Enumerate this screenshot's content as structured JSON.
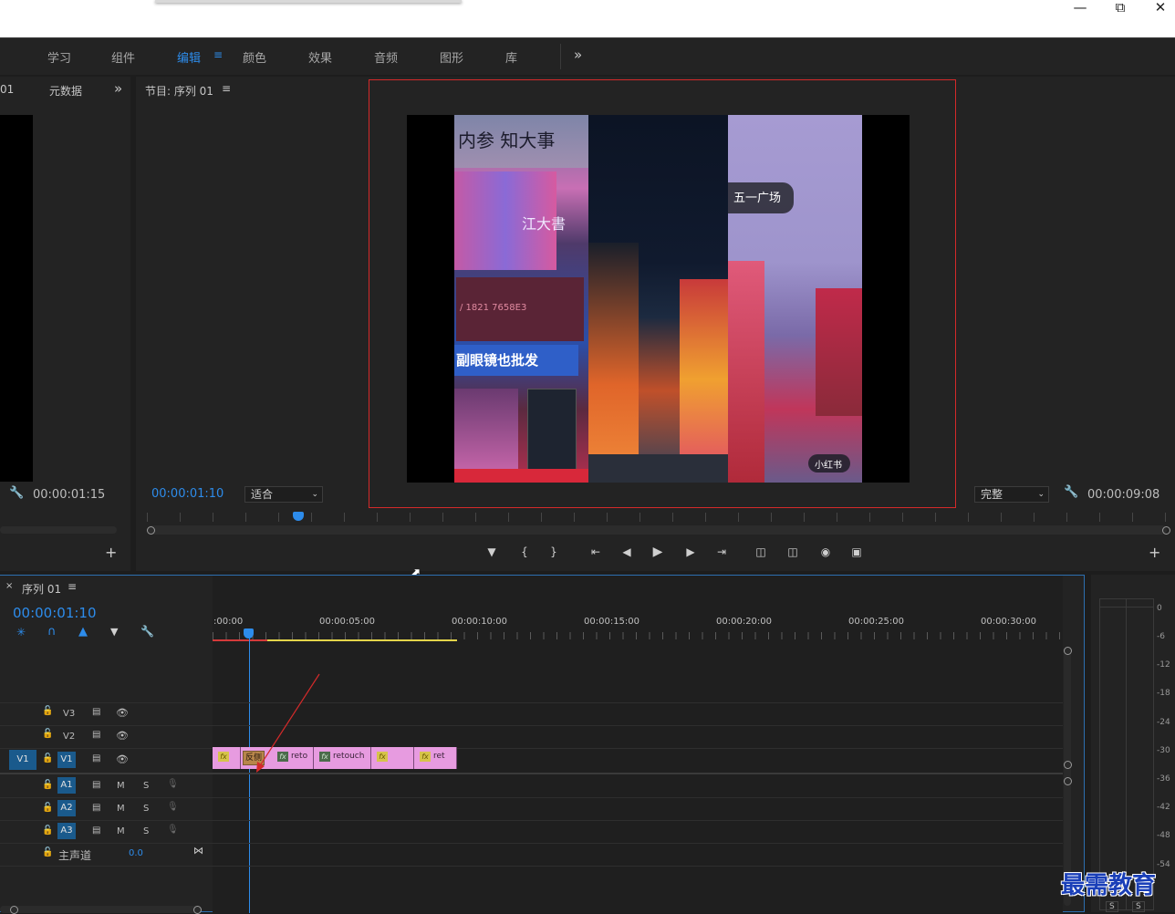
{
  "workspace_tabs": [
    "学习",
    "组件",
    "编辑",
    "颜色",
    "效果",
    "音频",
    "图形",
    "库"
  ],
  "active_workspace": "编辑",
  "source_panel": {
    "partial_tab": "01",
    "metadata_tab": "元数据",
    "timecode": "00:00:01:15"
  },
  "program_monitor": {
    "title": "节目: 序列 01",
    "timecode_current": "00:00:01:10",
    "fit_select": "适合",
    "quality_select": "完整",
    "timecode_duration": "00:00:09:08",
    "frame_text_1": "五一广场",
    "frame_text_2": "小红书",
    "frame_text_3": "副眼镜也批发"
  },
  "timeline": {
    "sequence_tab": "序列 01",
    "timecode": "00:00:01:10",
    "ruler_labels": [
      ":00:00",
      "00:00:05:00",
      "00:00:10:00",
      "00:00:15:00",
      "00:00:20:00",
      "00:00:25:00",
      "00:00:30:00"
    ],
    "video_tracks": [
      "V3",
      "V2",
      "V1"
    ],
    "source_patch": "V1",
    "audio_tracks": [
      "A1",
      "A2",
      "A3"
    ],
    "mute_label": "M",
    "solo_label": "S",
    "master_label": "主声道",
    "master_value": "0.0",
    "clips": [
      "fx",
      "反侧",
      "reto",
      "retouch",
      "fx",
      "ret"
    ]
  },
  "audio_meter": {
    "scale": [
      "0",
      "-6",
      "-12",
      "-18",
      "-24",
      "-30",
      "-36",
      "-42",
      "-48",
      "-54"
    ],
    "solo_buttons": [
      "S",
      "S"
    ]
  },
  "watermark": "最需教育",
  "colors": {
    "accent": "#2d8ceb",
    "clip_pink": "#e79be0",
    "highlight_red": "#d42a2a"
  }
}
